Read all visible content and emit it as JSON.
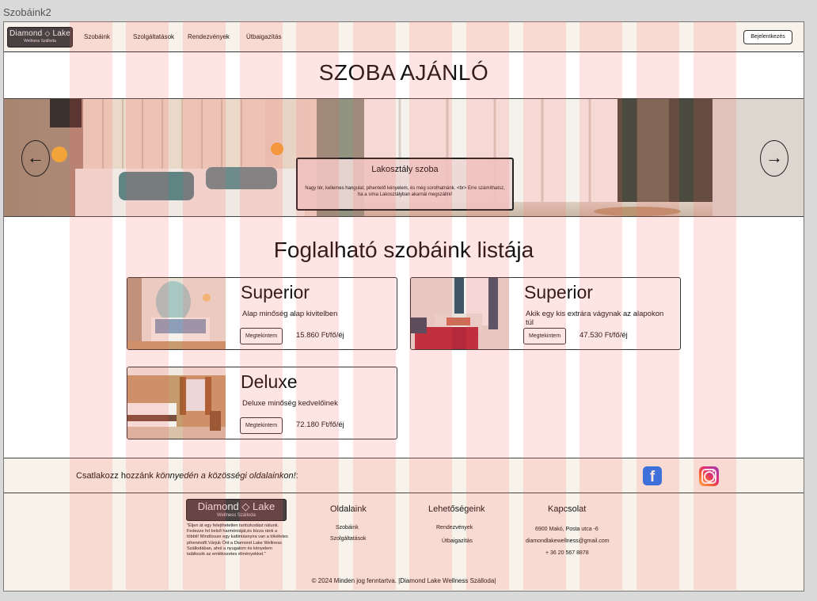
{
  "frame_title": "Szobáink2",
  "header": {
    "logo_brand": "Diamond",
    "logo_brand2": "Lake",
    "logo_sub": "Wellness Szálloda",
    "nav": [
      "Szobáink",
      "Szolgáltatások",
      "Rendezvények",
      "Útbaigazítás"
    ],
    "login_label": "Bejelentkezés"
  },
  "hero_title": "SZOBA AJÁNLÓ",
  "carousel": {
    "prev_glyph": "←",
    "next_glyph": "→",
    "caption_title": "Lakosztály szoba",
    "caption_text": "Nagy tér, kellemes hangulat, pihentető kényelem, és még sorolhatnánk. <br> Erre számíthatsz, ha a sima Lakosztályban akarnál megszállni!"
  },
  "rooms_title": "Foglalható szobáink listája",
  "rooms": [
    {
      "name": "Superior",
      "desc": "Alap minőség alap kivitelben",
      "button": "Megtekintem",
      "price": "15.860 Ft/fő/éj"
    },
    {
      "name": "Superior",
      "desc": "Akik egy kis extrára vágynak az alapokon túl",
      "button": "Megtekintem",
      "price": "47.530 Ft/fő/éj"
    },
    {
      "name": "Deluxe",
      "desc": "Deluxe minőség kedvelőinek",
      "button": "Megtekintem",
      "price": "72.180 Ft/fő/éj"
    }
  ],
  "social": {
    "join_a": "Csatlakozz hozzánk ",
    "join_b": "könnyedén a közösségi oldalainkon!",
    "join_c": ":",
    "facebook_letter": "f",
    "facebook_icon": "facebook-icon",
    "instagram_icon": "instagram-icon"
  },
  "footer": {
    "logo_brand": "Diamond",
    "logo_brand2": "Lake",
    "logo_sub": "Wellness Szálloda",
    "quote": "\"Éljen át egy felejthetetlen tartózkodást nálunk. Fedezze fel belső harmóniáját,és bízza ránk a többit! Mindössze egy kattintásnyira van a tökéletes pihenéstől.Várjuk Önt a Diamond Lake Wellness Szállodában, ahol a nyugalom és kényelem találkozik az emlékezetes élményekkel.\"",
    "col1_title": "Oldalaink",
    "col1_links": [
      "Szobáink",
      "Szolgáltatások"
    ],
    "col2_title": "Lehetőségeink",
    "col2_links": [
      "Rendezvények",
      "Útbaigazítás"
    ],
    "col3_title": "Kapcsolat",
    "col3_lines": [
      "6900 Makó, Posta utca -6",
      "diamondlakewellness@gmail.com",
      "+ 36 20 567 8878"
    ],
    "copyright": "© 2024 Minden jog fenntartva. |Diamond Lake Wellness Szálloda|"
  },
  "colors": {
    "header_bg": "#f8f3ea",
    "logo_bg": "#4a4143",
    "facebook": "#1877f2",
    "grid_overlay": "#ff5a5a"
  }
}
